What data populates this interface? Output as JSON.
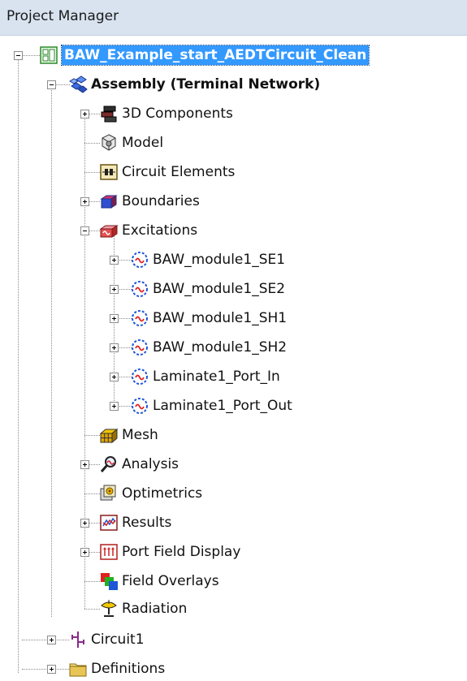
{
  "panel": {
    "title": "Project Manager"
  },
  "project": {
    "label": "BAW_Example_start_AEDTCircuit_Clean",
    "icon": "project-icon",
    "expanded": true,
    "selected": true
  },
  "assembly": {
    "label": "Assembly (Terminal Network)",
    "icon": "assembly-icon",
    "expanded": true
  },
  "design_items": [
    {
      "label": "3D Components",
      "icon": "3d-components-icon",
      "expandable": true,
      "expanded": false
    },
    {
      "label": "Model",
      "icon": "model-icon",
      "expandable": false
    },
    {
      "label": "Circuit Elements",
      "icon": "circuit-elements-icon",
      "expandable": false
    },
    {
      "label": "Boundaries",
      "icon": "boundaries-icon",
      "expandable": true,
      "expanded": false
    },
    {
      "label": "Excitations",
      "icon": "excitations-icon",
      "expandable": true,
      "expanded": true
    },
    {
      "label": "Mesh",
      "icon": "mesh-icon",
      "expandable": false
    },
    {
      "label": "Analysis",
      "icon": "analysis-icon",
      "expandable": true,
      "expanded": false
    },
    {
      "label": "Optimetrics",
      "icon": "optimetrics-icon",
      "expandable": false
    },
    {
      "label": "Results",
      "icon": "results-icon",
      "expandable": true,
      "expanded": false
    },
    {
      "label": "Port Field Display",
      "icon": "port-field-display-icon",
      "expandable": true,
      "expanded": false
    },
    {
      "label": "Field Overlays",
      "icon": "field-overlays-icon",
      "expandable": false
    },
    {
      "label": "Radiation",
      "icon": "radiation-icon",
      "expandable": false
    }
  ],
  "excitations": [
    {
      "label": "BAW_module1_SE1",
      "icon": "port-icon"
    },
    {
      "label": "BAW_module1_SE2",
      "icon": "port-icon"
    },
    {
      "label": "BAW_module1_SH1",
      "icon": "port-icon"
    },
    {
      "label": "BAW_module1_SH2",
      "icon": "port-icon"
    },
    {
      "label": "Laminate1_Port_In",
      "icon": "port-icon"
    },
    {
      "label": "Laminate1_Port_Out",
      "icon": "port-icon"
    }
  ],
  "project_items": [
    {
      "label": "Circuit1",
      "icon": "circuit-icon",
      "expandable": true,
      "expanded": false
    },
    {
      "label": "Definitions",
      "icon": "folder-icon",
      "expandable": true,
      "expanded": false
    }
  ],
  "colors": {
    "header_bg": "#d9e3f0",
    "selection_bg": "#3399ff",
    "selection_text": "#ffffff"
  }
}
